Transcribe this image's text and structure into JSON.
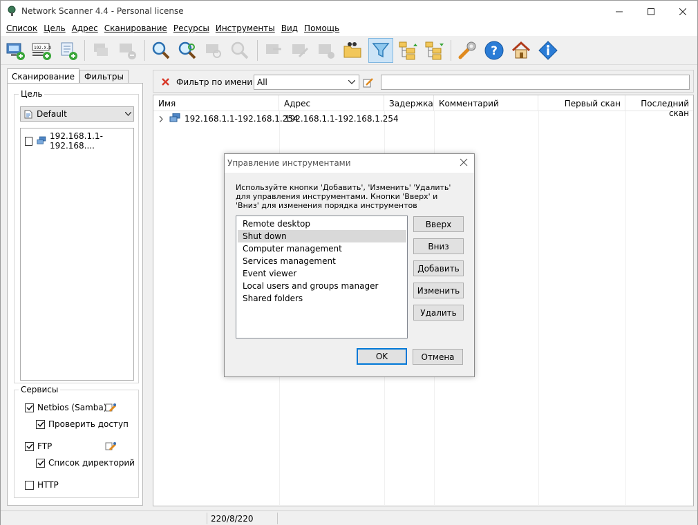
{
  "window": {
    "title": "Network Scanner 4.4 - Personal license"
  },
  "menu": [
    "Список",
    "Цель",
    "Адрес",
    "Сканирование",
    "Ресурсы",
    "Инструменты",
    "Вид",
    "Помощь"
  ],
  "left": {
    "tabs": [
      "Сканирование",
      "Фильтры"
    ],
    "target_group": "Цель",
    "target_profile": "Default",
    "targets": [
      "192.168.1.1-192.168...."
    ],
    "services_group": "Сервисы",
    "services": [
      {
        "label": "Netbios (Samba)",
        "checked": true
      },
      {
        "label": "Проверить доступ",
        "checked": true
      },
      {
        "label": "FTP",
        "checked": true
      },
      {
        "label": "Список директорий",
        "checked": true
      },
      {
        "label": "HTTP",
        "checked": false
      }
    ]
  },
  "filter": {
    "label": "Фильтр по имени",
    "value": "All",
    "text": ""
  },
  "grid": {
    "columns": [
      "Имя",
      "Адрес",
      "Задержка",
      "Комментарий",
      "Первый скан",
      "Последний скан"
    ],
    "rows": [
      {
        "name": "192.168.1.1-192.168.1.254",
        "address": "192.168.1.1-192.168.1.254"
      }
    ]
  },
  "status": {
    "counts": "220/8/220"
  },
  "dialog": {
    "title": "Управление инструментами",
    "description": "Используйте кнопки 'Добавить', 'Изменить' 'Удалить' для управления инструментами. Кнопки 'Вверх' и 'Вниз' для изменения порядка инструментов",
    "items": [
      "Remote desktop",
      "Shut down",
      "Computer management",
      "Services management",
      "Event viewer",
      "Local users and groups manager",
      "Shared folders"
    ],
    "selected_index": 1,
    "buttons": {
      "up": "Вверх",
      "down": "Вниз",
      "add": "Добавить",
      "edit": "Изменить",
      "delete": "Удалить",
      "ok": "OK",
      "cancel": "Отмена"
    }
  },
  "colors": {
    "accent": "#0078d7",
    "filter_active": "#cce4f7",
    "selection": "#d9d9d9"
  }
}
